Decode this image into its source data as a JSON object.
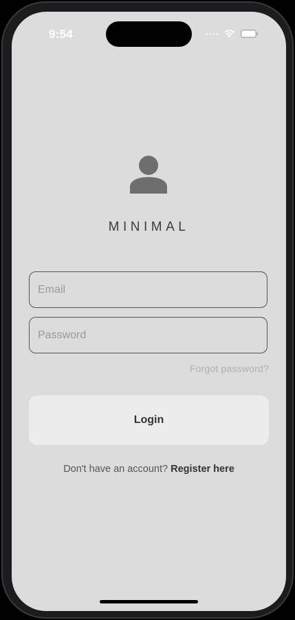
{
  "status_bar": {
    "time": "9:54",
    "icons": [
      "cellular-signal-icon",
      "wifi-icon",
      "battery-icon"
    ]
  },
  "app": {
    "logo_icon": "user-avatar-icon",
    "title": "MINIMAL"
  },
  "form": {
    "email_placeholder": "Email",
    "email_value": "",
    "password_placeholder": "Password",
    "password_value": "",
    "forgot_label": "Forgot password?",
    "login_label": "Login"
  },
  "register": {
    "prompt": "Don't have an account?",
    "link_label": "Register here"
  },
  "colors": {
    "background": "#dcdcdc",
    "field_border": "#4d5a52",
    "button_bg": "#ececec",
    "icon": "#6e6e6e"
  }
}
